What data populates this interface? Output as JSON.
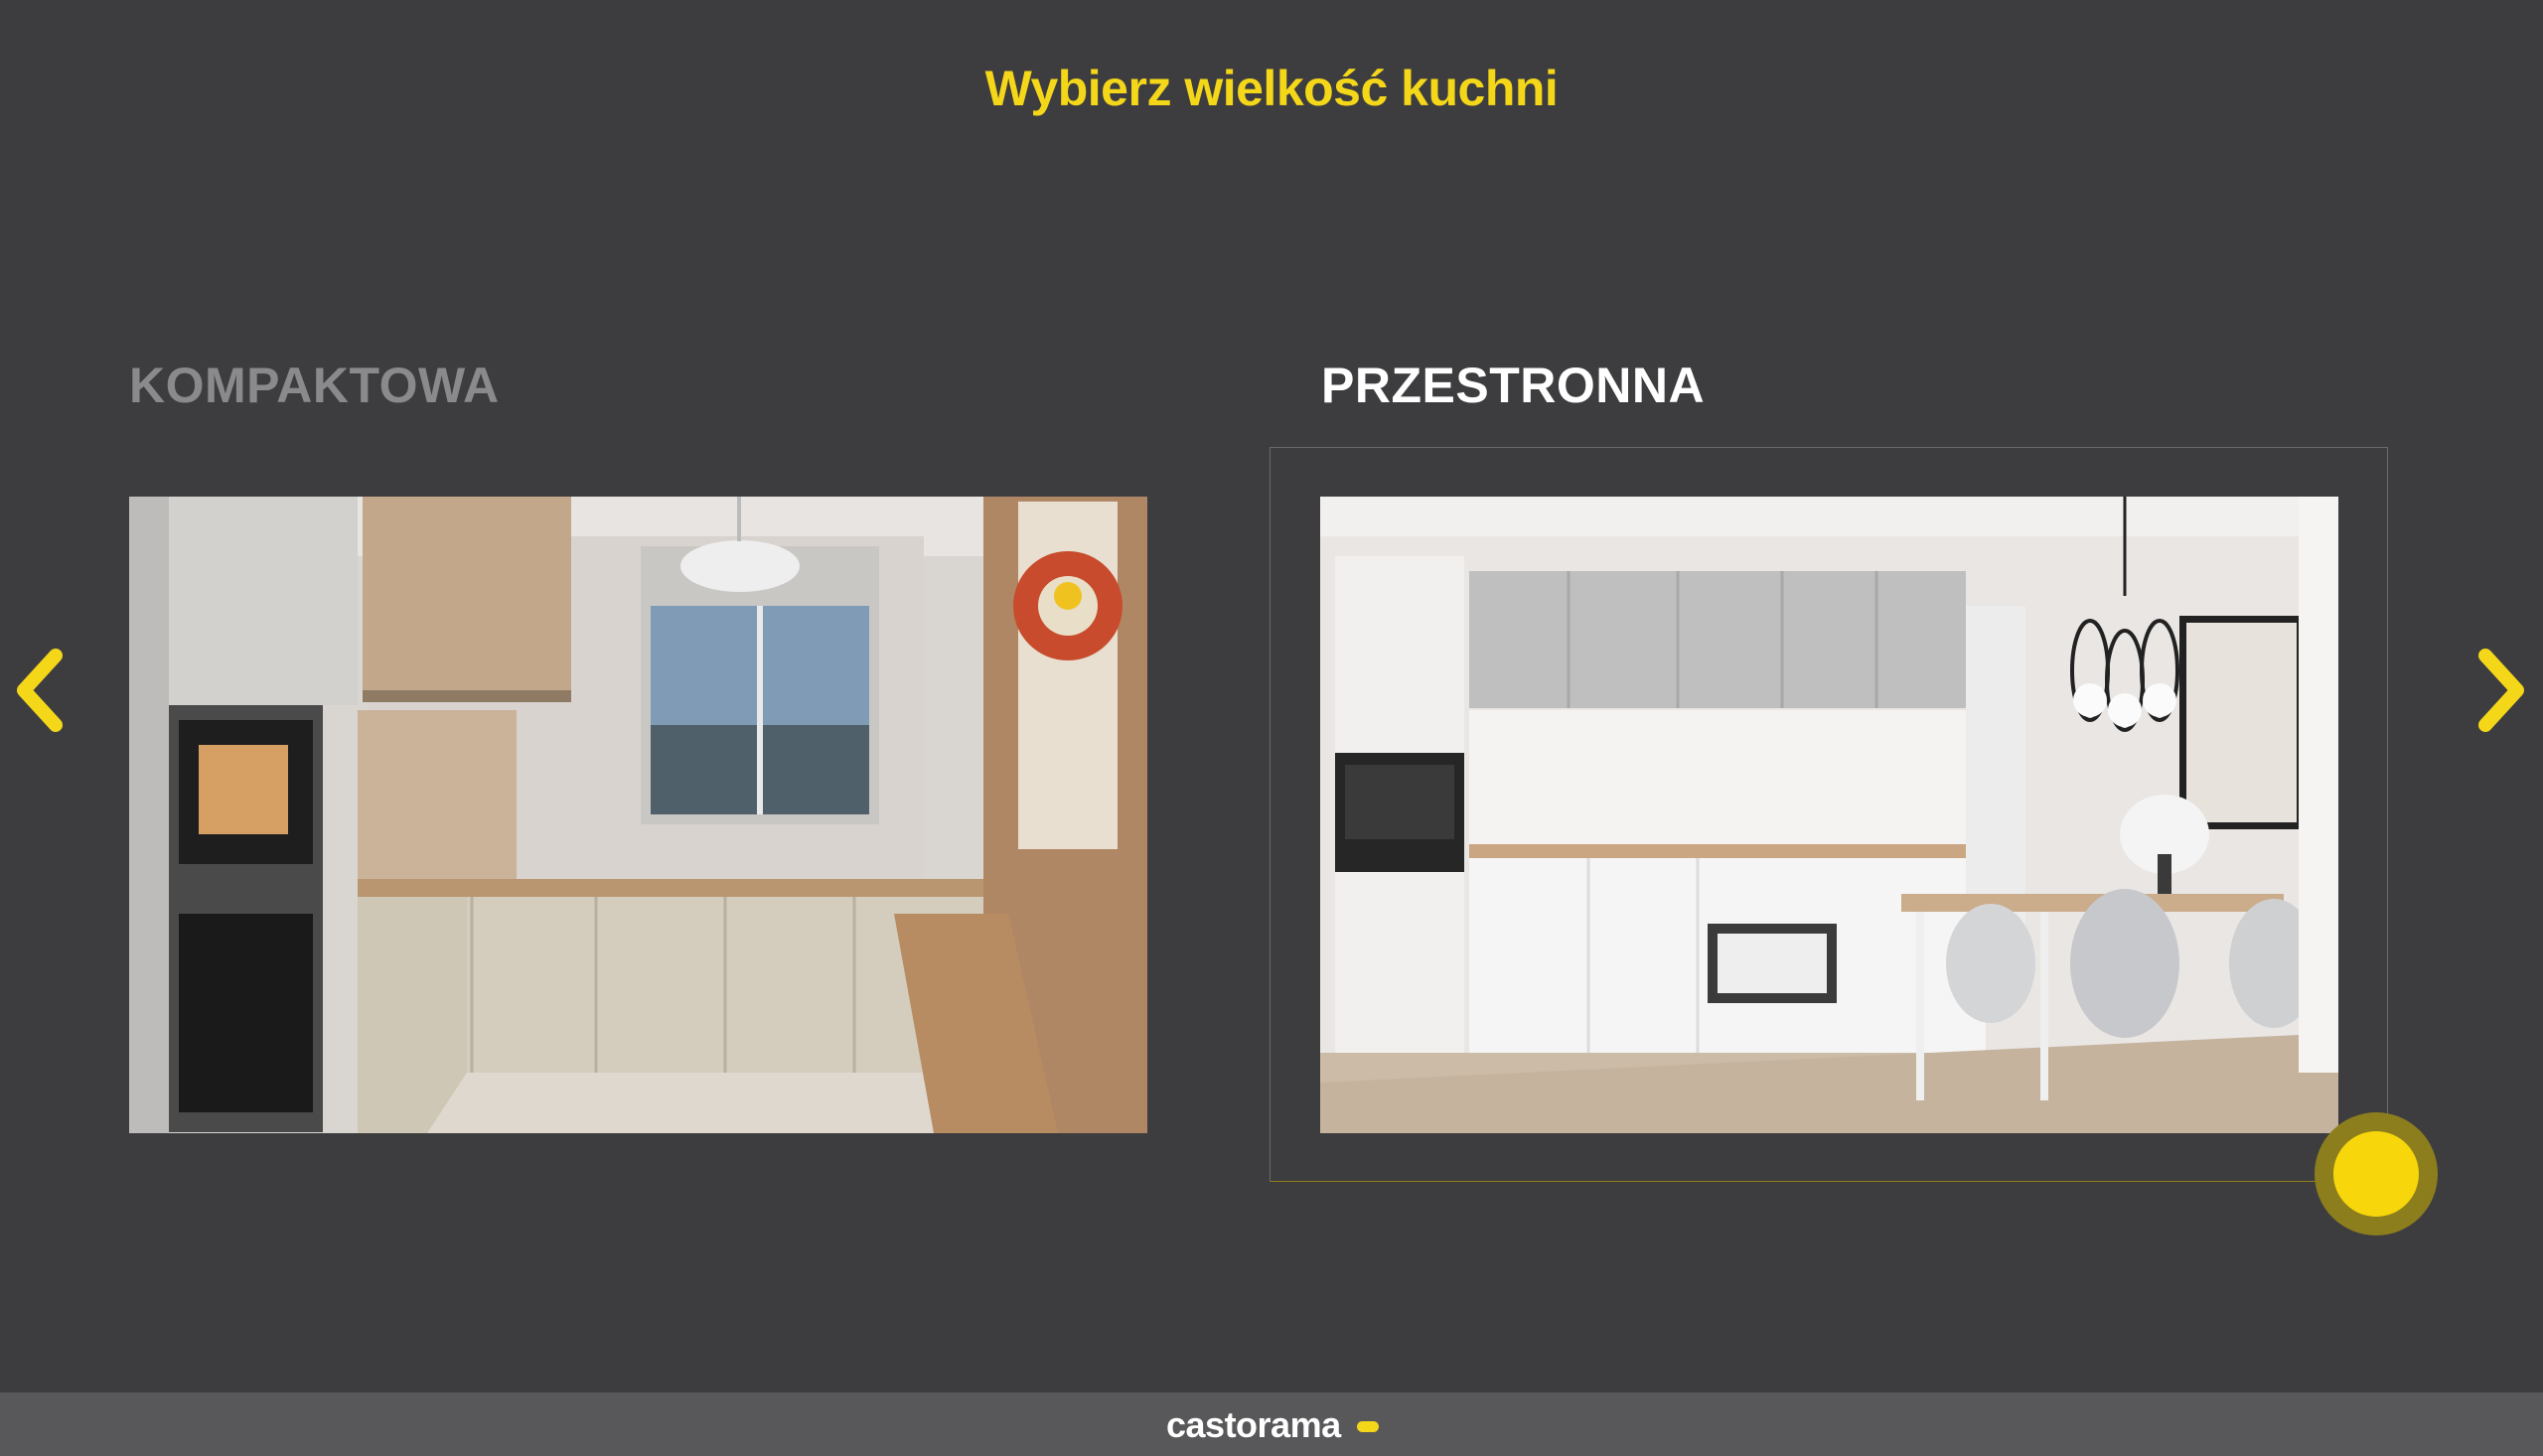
{
  "header": {
    "title": "Wybierz wielkość kuchni"
  },
  "options": [
    {
      "label": "KOMPAKTOWA",
      "selected": false,
      "image": "compact-kitchen-photo"
    },
    {
      "label": "PRZESTRONNA",
      "selected": true,
      "image": "spacious-kitchen-photo"
    }
  ],
  "navigation": {
    "prev_icon": "chevron-left-icon",
    "next_icon": "chevron-right-icon"
  },
  "footer": {
    "brand": "castorama"
  },
  "colors": {
    "accent": "#f5d71a",
    "background": "#3d3d3f",
    "footer": "#58585a"
  }
}
